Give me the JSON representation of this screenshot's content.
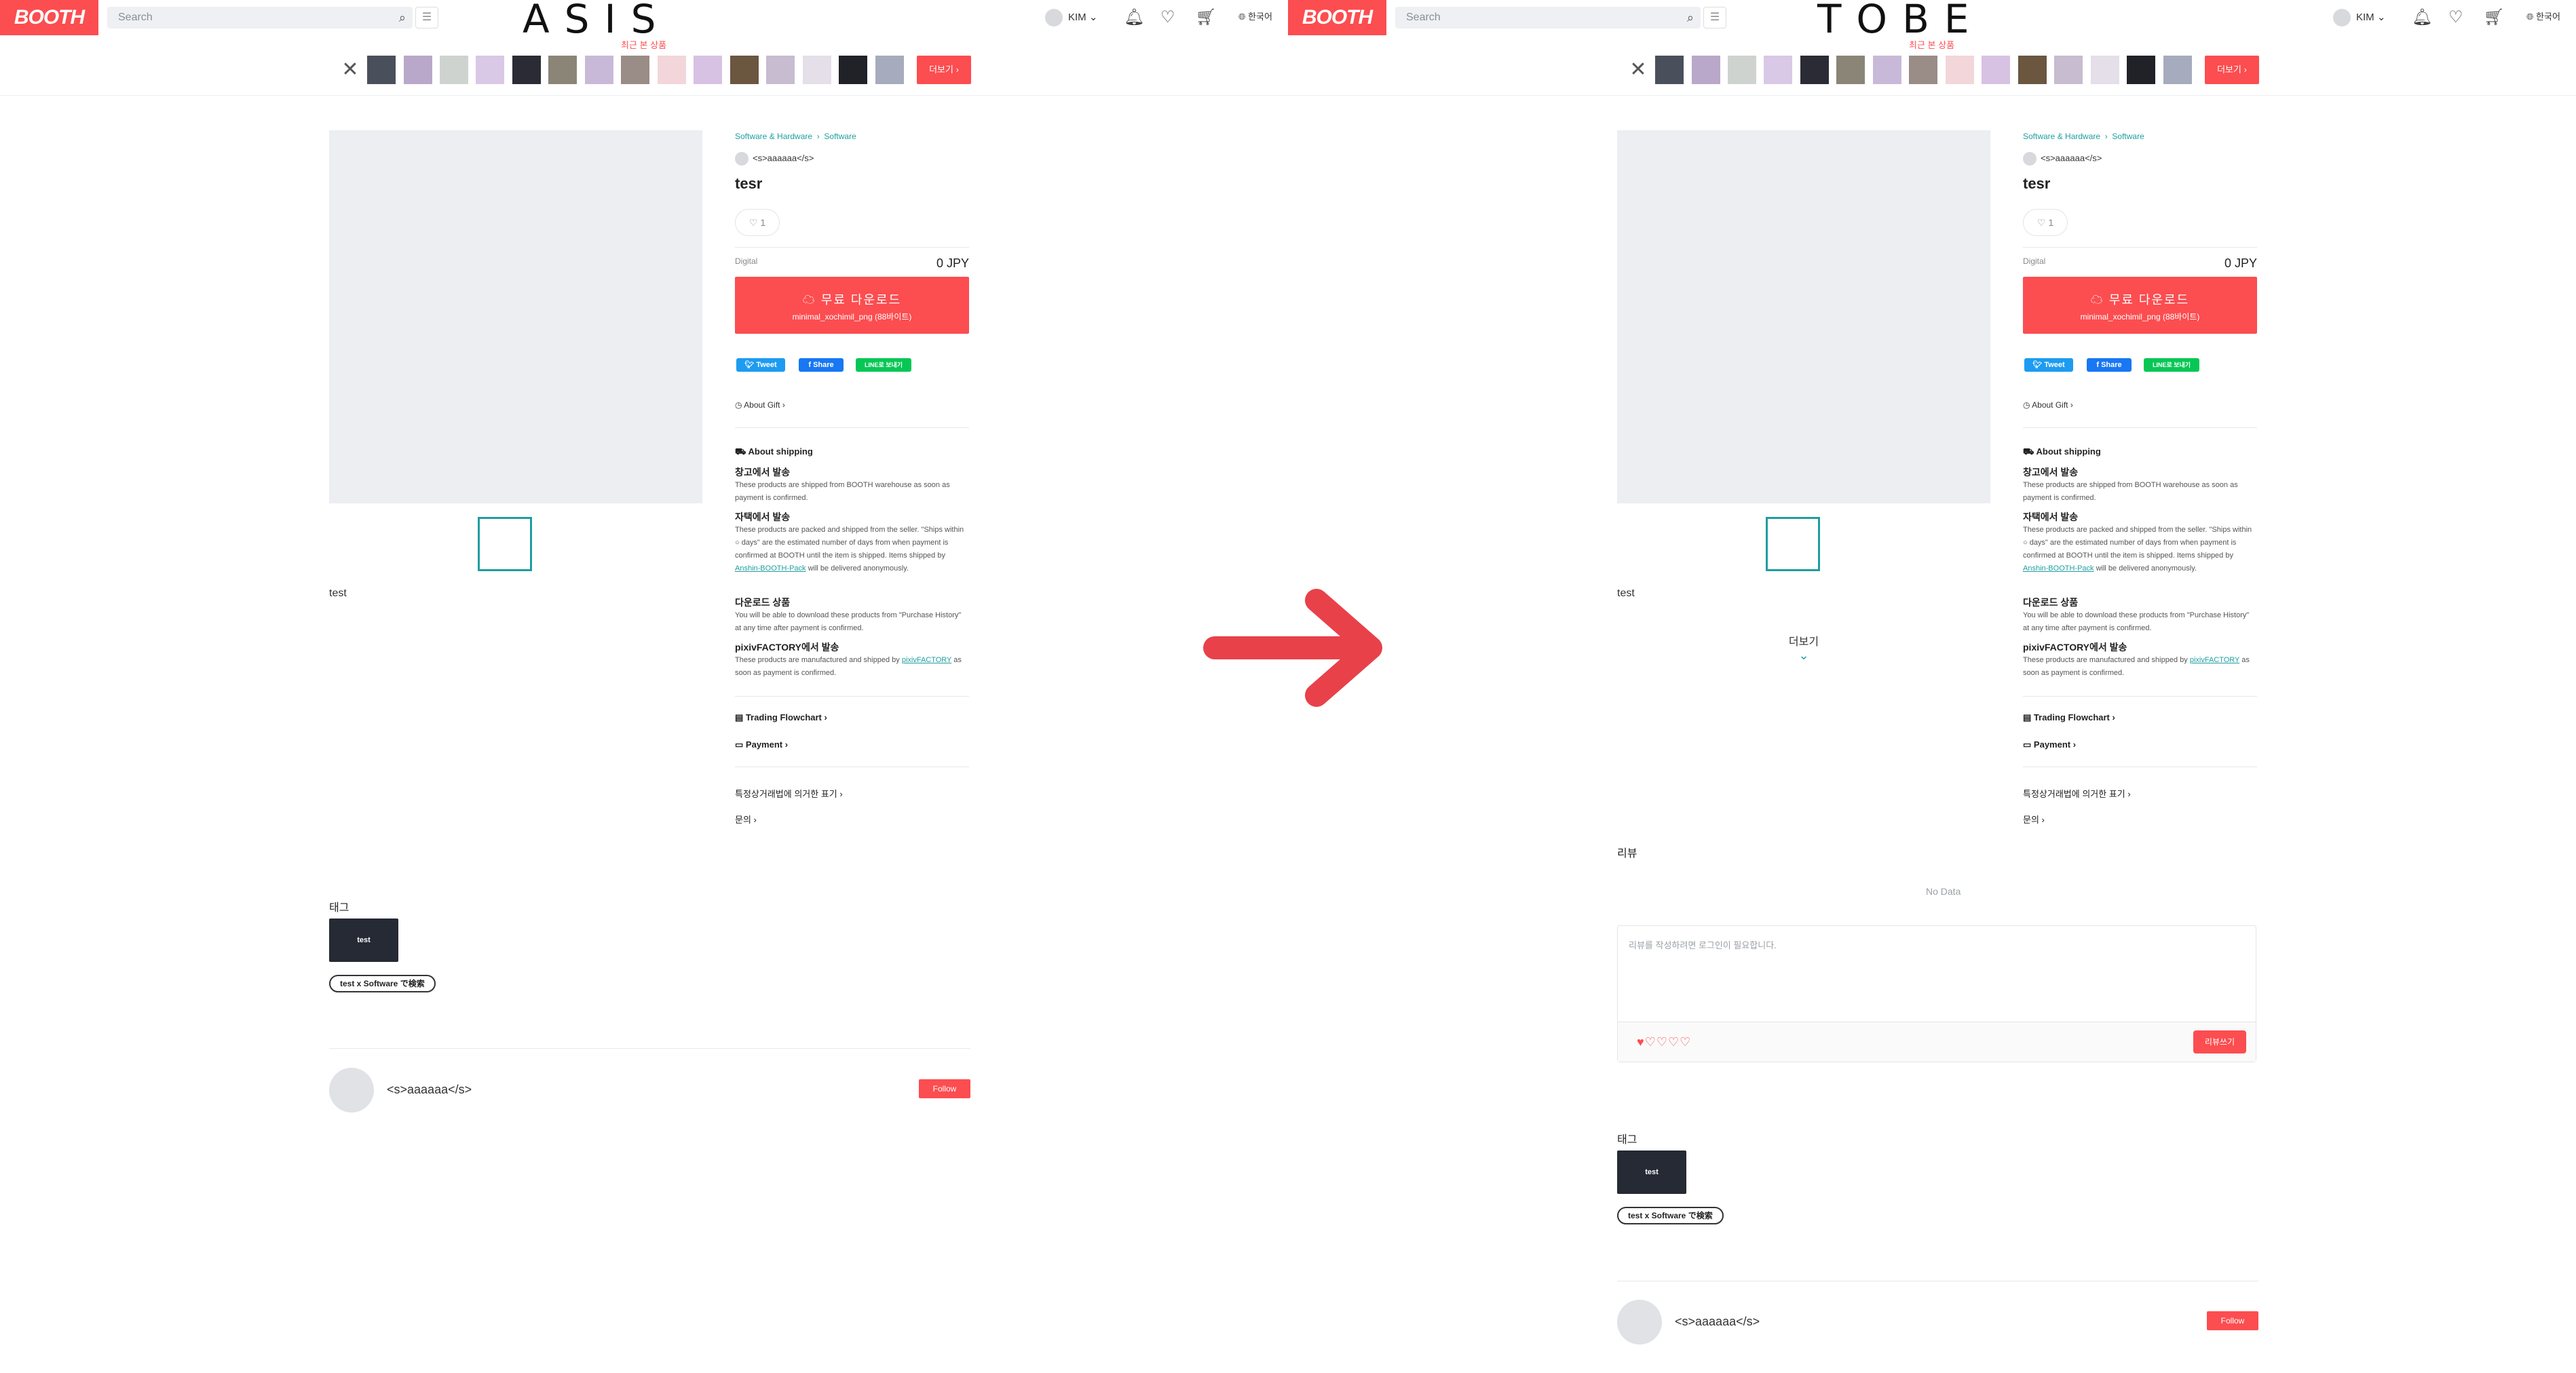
{
  "colors": {
    "brand": "#fc4d50",
    "accent": "#1e9ea0",
    "dark_tag": "#252a34",
    "tweet": "#1d9bf0",
    "facebook": "#1877f2",
    "line": "#06c755",
    "arrow": "#e8414a"
  },
  "header": {
    "logo": "BOOTH",
    "search_placeholder": "Search",
    "user_name": "KIM",
    "language": "한국어",
    "icons": [
      "search-icon",
      "menu-icon",
      "bell-icon",
      "heart-icon",
      "cart-icon",
      "globe-icon"
    ]
  },
  "labels": {
    "asis": "ASIS",
    "tobe": "TOBE"
  },
  "recent": {
    "label": "최근 본 상품",
    "more": "더보기"
  },
  "product": {
    "breadcrumb_1": "Software & Hardware",
    "breadcrumb_2": "Software",
    "shop_name": "<s>aaaaaa</s>",
    "title": "tesr",
    "likes": "1",
    "type": "Digital",
    "price": "0 JPY",
    "download_label": "무료 다운로드",
    "download_file": "minimal_xochimil_png (88바이트)",
    "tweet": "Tweet",
    "share": "Share",
    "line": "LINE로 보내기",
    "gift": "About Gift",
    "description": "test"
  },
  "shipping": {
    "heading": "About shipping",
    "warehouse_title": "창고에서 발송",
    "warehouse_text": "These products are shipped from BOOTH warehouse as soon as payment is confirmed.",
    "self_title": "자택에서 발송",
    "self_text_1": "These products are packed and shipped from the seller. \"Ships within ○ days\" are the estimated number of days from when payment is confirmed at BOOTH until the item is shipped. Items shipped by ",
    "self_link": "Anshin-BOOTH-Pack",
    "self_text_2": " will be delivered anonymously.",
    "download_title": "다운로드 상품",
    "download_text": "You will be able to download these products from \"Purchase History\" at any time after payment is confirmed.",
    "pixiv_title": "pixivFACTORY에서 발송",
    "pixiv_text_1": "These products are manufactured and shipped by ",
    "pixiv_link": "pixivFACTORY",
    "pixiv_text_2": " as soon as payment is confirmed."
  },
  "links": {
    "flowchart": "Trading Flowchart",
    "payment": "Payment",
    "law": "특정상거래법에 의거한 표기",
    "inquiry": "문의"
  },
  "tags": {
    "heading": "태그",
    "tag": "test",
    "search": "test x Software で検索"
  },
  "shop_footer": {
    "name": "<s>aaaaaa</s>",
    "follow": "Follow"
  },
  "tobe_extra": {
    "readmore": "더보기",
    "review_heading": "리뷰",
    "no_data": "No Data",
    "review_placeholder": "리뷰를 작성하려면 로그인이 필요합니다.",
    "review_rating": 1,
    "review_submit": "리뷰쓰기"
  }
}
